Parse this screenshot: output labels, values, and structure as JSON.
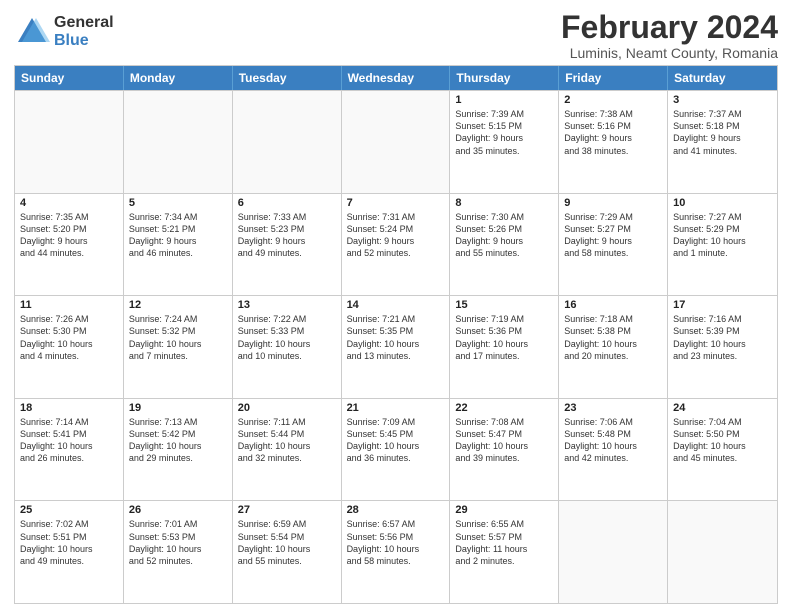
{
  "logo": {
    "general": "General",
    "blue": "Blue"
  },
  "title": "February 2024",
  "subtitle": "Luminis, Neamt County, Romania",
  "days_header": [
    "Sunday",
    "Monday",
    "Tuesday",
    "Wednesday",
    "Thursday",
    "Friday",
    "Saturday"
  ],
  "rows": [
    [
      {
        "day": "",
        "info": ""
      },
      {
        "day": "",
        "info": ""
      },
      {
        "day": "",
        "info": ""
      },
      {
        "day": "",
        "info": ""
      },
      {
        "day": "1",
        "info": "Sunrise: 7:39 AM\nSunset: 5:15 PM\nDaylight: 9 hours\nand 35 minutes."
      },
      {
        "day": "2",
        "info": "Sunrise: 7:38 AM\nSunset: 5:16 PM\nDaylight: 9 hours\nand 38 minutes."
      },
      {
        "day": "3",
        "info": "Sunrise: 7:37 AM\nSunset: 5:18 PM\nDaylight: 9 hours\nand 41 minutes."
      }
    ],
    [
      {
        "day": "4",
        "info": "Sunrise: 7:35 AM\nSunset: 5:20 PM\nDaylight: 9 hours\nand 44 minutes."
      },
      {
        "day": "5",
        "info": "Sunrise: 7:34 AM\nSunset: 5:21 PM\nDaylight: 9 hours\nand 46 minutes."
      },
      {
        "day": "6",
        "info": "Sunrise: 7:33 AM\nSunset: 5:23 PM\nDaylight: 9 hours\nand 49 minutes."
      },
      {
        "day": "7",
        "info": "Sunrise: 7:31 AM\nSunset: 5:24 PM\nDaylight: 9 hours\nand 52 minutes."
      },
      {
        "day": "8",
        "info": "Sunrise: 7:30 AM\nSunset: 5:26 PM\nDaylight: 9 hours\nand 55 minutes."
      },
      {
        "day": "9",
        "info": "Sunrise: 7:29 AM\nSunset: 5:27 PM\nDaylight: 9 hours\nand 58 minutes."
      },
      {
        "day": "10",
        "info": "Sunrise: 7:27 AM\nSunset: 5:29 PM\nDaylight: 10 hours\nand 1 minute."
      }
    ],
    [
      {
        "day": "11",
        "info": "Sunrise: 7:26 AM\nSunset: 5:30 PM\nDaylight: 10 hours\nand 4 minutes."
      },
      {
        "day": "12",
        "info": "Sunrise: 7:24 AM\nSunset: 5:32 PM\nDaylight: 10 hours\nand 7 minutes."
      },
      {
        "day": "13",
        "info": "Sunrise: 7:22 AM\nSunset: 5:33 PM\nDaylight: 10 hours\nand 10 minutes."
      },
      {
        "day": "14",
        "info": "Sunrise: 7:21 AM\nSunset: 5:35 PM\nDaylight: 10 hours\nand 13 minutes."
      },
      {
        "day": "15",
        "info": "Sunrise: 7:19 AM\nSunset: 5:36 PM\nDaylight: 10 hours\nand 17 minutes."
      },
      {
        "day": "16",
        "info": "Sunrise: 7:18 AM\nSunset: 5:38 PM\nDaylight: 10 hours\nand 20 minutes."
      },
      {
        "day": "17",
        "info": "Sunrise: 7:16 AM\nSunset: 5:39 PM\nDaylight: 10 hours\nand 23 minutes."
      }
    ],
    [
      {
        "day": "18",
        "info": "Sunrise: 7:14 AM\nSunset: 5:41 PM\nDaylight: 10 hours\nand 26 minutes."
      },
      {
        "day": "19",
        "info": "Sunrise: 7:13 AM\nSunset: 5:42 PM\nDaylight: 10 hours\nand 29 minutes."
      },
      {
        "day": "20",
        "info": "Sunrise: 7:11 AM\nSunset: 5:44 PM\nDaylight: 10 hours\nand 32 minutes."
      },
      {
        "day": "21",
        "info": "Sunrise: 7:09 AM\nSunset: 5:45 PM\nDaylight: 10 hours\nand 36 minutes."
      },
      {
        "day": "22",
        "info": "Sunrise: 7:08 AM\nSunset: 5:47 PM\nDaylight: 10 hours\nand 39 minutes."
      },
      {
        "day": "23",
        "info": "Sunrise: 7:06 AM\nSunset: 5:48 PM\nDaylight: 10 hours\nand 42 minutes."
      },
      {
        "day": "24",
        "info": "Sunrise: 7:04 AM\nSunset: 5:50 PM\nDaylight: 10 hours\nand 45 minutes."
      }
    ],
    [
      {
        "day": "25",
        "info": "Sunrise: 7:02 AM\nSunset: 5:51 PM\nDaylight: 10 hours\nand 49 minutes."
      },
      {
        "day": "26",
        "info": "Sunrise: 7:01 AM\nSunset: 5:53 PM\nDaylight: 10 hours\nand 52 minutes."
      },
      {
        "day": "27",
        "info": "Sunrise: 6:59 AM\nSunset: 5:54 PM\nDaylight: 10 hours\nand 55 minutes."
      },
      {
        "day": "28",
        "info": "Sunrise: 6:57 AM\nSunset: 5:56 PM\nDaylight: 10 hours\nand 58 minutes."
      },
      {
        "day": "29",
        "info": "Sunrise: 6:55 AM\nSunset: 5:57 PM\nDaylight: 11 hours\nand 2 minutes."
      },
      {
        "day": "",
        "info": ""
      },
      {
        "day": "",
        "info": ""
      }
    ]
  ]
}
